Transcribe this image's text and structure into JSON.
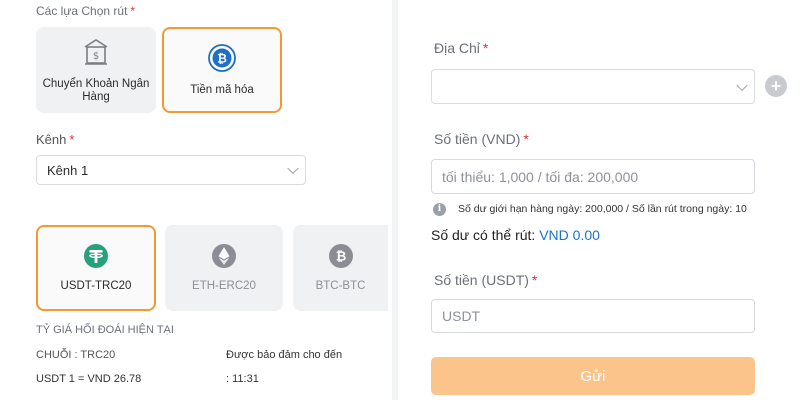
{
  "withdraw_options": {
    "label": "Các lựa Chọn rút",
    "required_mark": "*",
    "items": [
      {
        "label": "Chuyển Khoản Ngân Hàng",
        "icon": "bank-transfer-icon",
        "selected": false
      },
      {
        "label": "Tiền mã hóa",
        "icon": "bitcoin-icon",
        "selected": true
      }
    ]
  },
  "channel": {
    "label": "Kênh",
    "required_mark": "*",
    "value": "Kênh 1"
  },
  "coins": [
    {
      "label": "USDT-TRC20",
      "icon": "tether-icon",
      "selected": true
    },
    {
      "label": "ETH-ERC20",
      "icon": "ethereum-icon",
      "selected": false
    },
    {
      "label": "BTC-BTC",
      "icon": "bitcoin-icon",
      "selected": false
    }
  ],
  "exchange": {
    "heading": "TỶ GIÁ HỐI ĐOÁI HIỆN TẠI",
    "chain": "CHUỖI : TRC20",
    "guarantee_label": "Được bảo đảm cho đến",
    "rate": "USDT 1 = VND 26.78",
    "time": ": 11:31"
  },
  "form": {
    "address": {
      "label": "Địa Chỉ",
      "required_mark": "*",
      "value": ""
    },
    "amount_vnd": {
      "label": "Số tiền (VND)",
      "required_mark": "*",
      "placeholder": "tối thiểu: 1,000 / tối đa: 200,000"
    },
    "limit_info": "Số dư giới hạn hàng ngày: 200,000 / Số lần rút trong ngày: 10",
    "withdrawable_label": "Số dư có thể rút:",
    "withdrawable_value": "VND 0.00",
    "amount_usdt": {
      "label": "Số tiền (USDT)",
      "required_mark": "*",
      "placeholder": "USDT"
    },
    "submit_label": "Gửi"
  },
  "colors": {
    "accent": "#f29a32",
    "submit_bg": "#fbc48a",
    "link_blue": "#1a73c8",
    "required_red": "#e0303a",
    "tether": "#26a17b",
    "bitcoin_blue": "#1f6fc4"
  }
}
